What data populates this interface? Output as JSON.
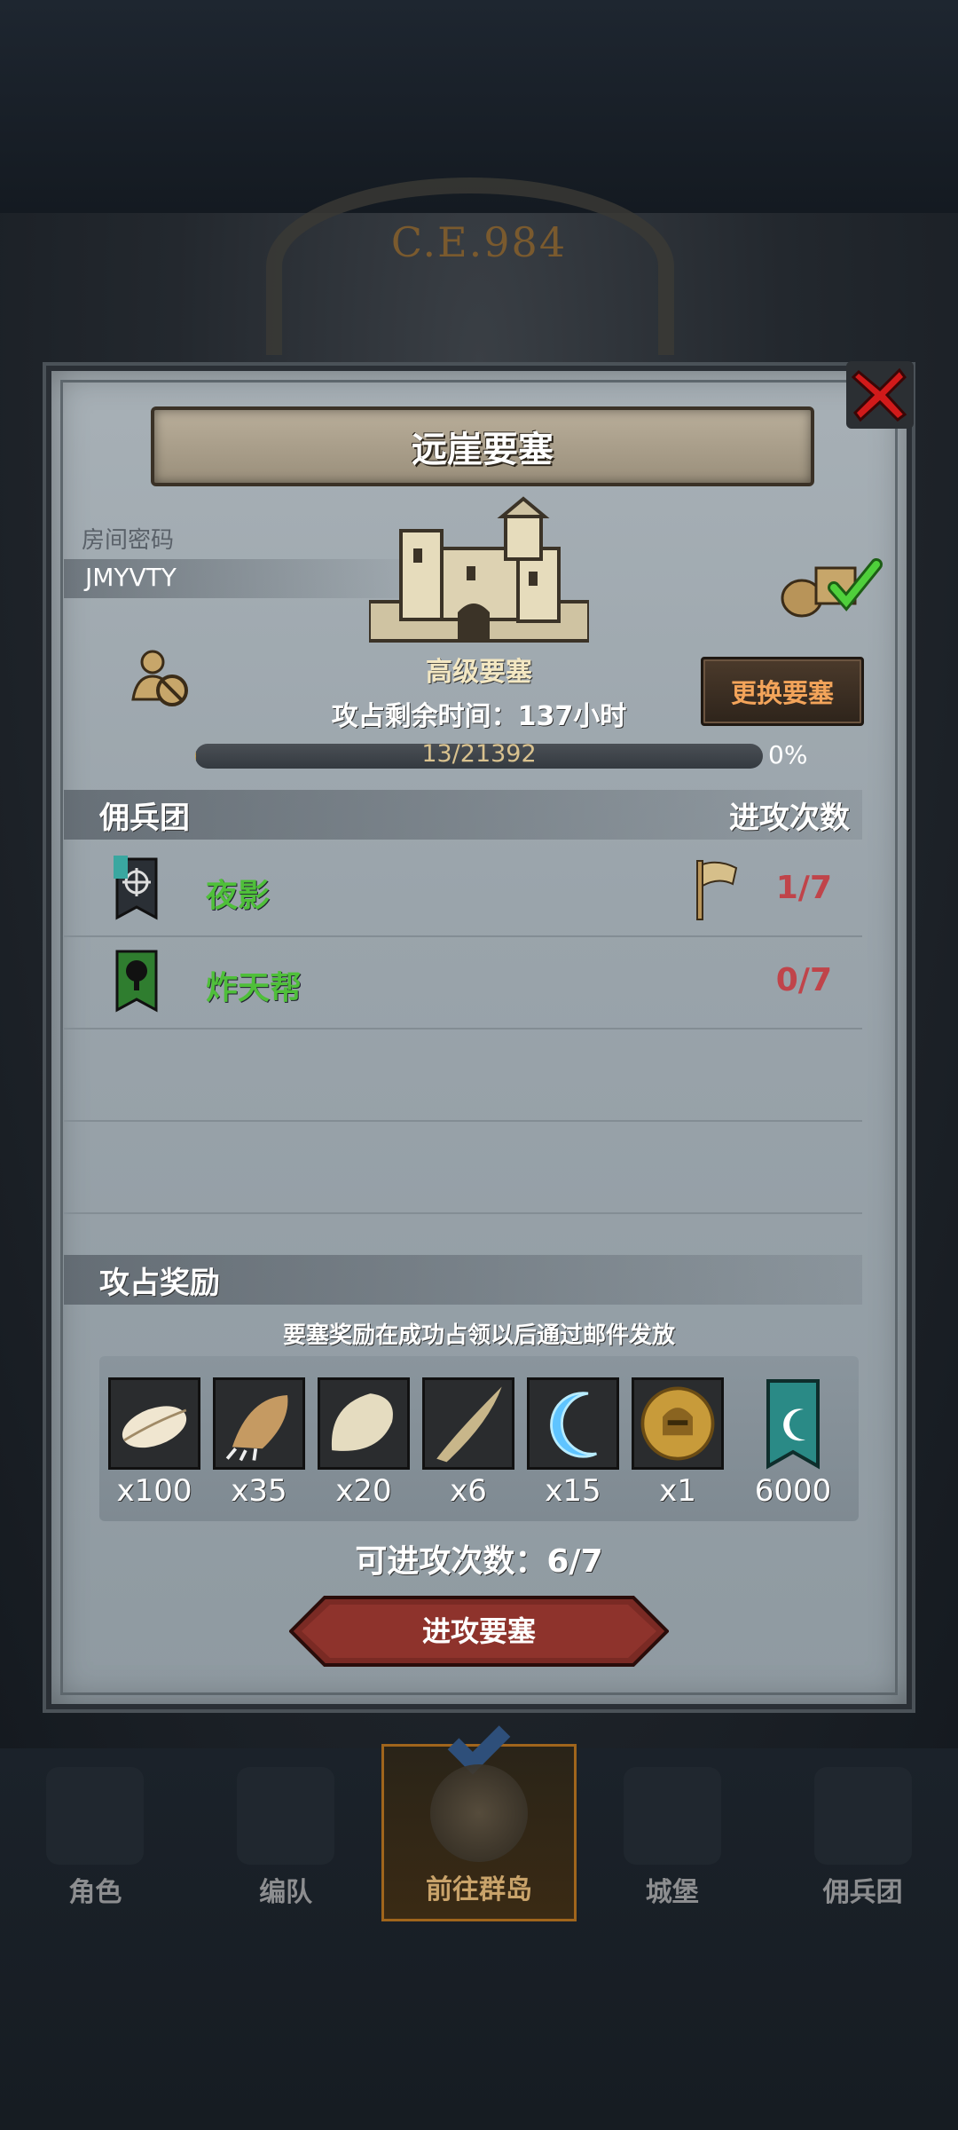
{
  "background": {
    "era": "C.E.984"
  },
  "dialog": {
    "title": "远崖要塞",
    "room_label": "房间密码",
    "room_code": "JMYVTY",
    "fortress_level": "高级要塞",
    "time_remaining": "攻占剩余时间：137小时",
    "change_button": "更换要塞",
    "progress": {
      "text": "13/21392",
      "percent_label": "0%",
      "fraction": 0.0006
    },
    "mercenary_header": "佣兵团",
    "attacks_header": "进攻次数",
    "mercenaries": [
      {
        "name": "夜影",
        "count": "1/7"
      },
      {
        "name": "炸天帮",
        "count": "0/7"
      }
    ],
    "rewards_header": "攻占奖励",
    "rewards_note": "要塞奖励在成功占领以后通过邮件发放",
    "rewards": [
      {
        "icon": "feather-icon",
        "qty": "x100"
      },
      {
        "icon": "claw-icon",
        "qty": "x35"
      },
      {
        "icon": "fur-icon",
        "qty": "x20"
      },
      {
        "icon": "horn-icon",
        "qty": "x6"
      },
      {
        "icon": "blue-crescent-icon",
        "qty": "x15"
      },
      {
        "icon": "gold-helmet-coin-icon",
        "qty": "x1"
      },
      {
        "icon": "guild-banner-icon",
        "qty": "6000"
      }
    ],
    "attempts": "可进攻次数：6/7",
    "attack_button": "进攻要塞"
  },
  "nav": {
    "items": [
      {
        "label": "角色",
        "active": false
      },
      {
        "label": "编队",
        "active": false
      },
      {
        "label": "前往群岛",
        "active": true
      },
      {
        "label": "城堡",
        "active": false
      },
      {
        "label": "佣兵团",
        "active": false
      }
    ]
  },
  "colors": {
    "accent_green": "#4fbf3a",
    "count_red": "#c0444a",
    "button_orange": "#f3a45a"
  }
}
